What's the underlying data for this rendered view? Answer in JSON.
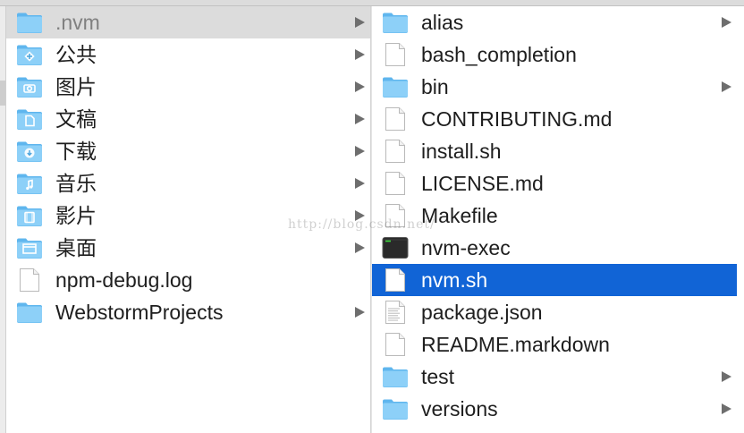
{
  "column1": {
    "items": [
      {
        "label": ".nvm",
        "icon": "folder-icon",
        "has_children": true,
        "selected": "gray"
      },
      {
        "label": "公共",
        "icon": "public-folder-icon",
        "has_children": true
      },
      {
        "label": "图片",
        "icon": "pictures-folder-icon",
        "has_children": true
      },
      {
        "label": "文稿",
        "icon": "documents-folder-icon",
        "has_children": true
      },
      {
        "label": "下载",
        "icon": "downloads-folder-icon",
        "has_children": true
      },
      {
        "label": "音乐",
        "icon": "music-folder-icon",
        "has_children": true
      },
      {
        "label": "影片",
        "icon": "movies-folder-icon",
        "has_children": true
      },
      {
        "label": "桌面",
        "icon": "desktop-folder-icon",
        "has_children": true
      },
      {
        "label": "npm-debug.log",
        "icon": "file-icon",
        "has_children": false
      },
      {
        "label": "WebstormProjects",
        "icon": "folder-icon",
        "has_children": true
      }
    ]
  },
  "column2": {
    "items": [
      {
        "label": "alias",
        "icon": "folder-icon",
        "has_children": true
      },
      {
        "label": "bash_completion",
        "icon": "file-icon",
        "has_children": false
      },
      {
        "label": "bin",
        "icon": "folder-icon",
        "has_children": true
      },
      {
        "label": "CONTRIBUTING.md",
        "icon": "file-icon",
        "has_children": false
      },
      {
        "label": "install.sh",
        "icon": "file-icon",
        "has_children": false
      },
      {
        "label": "LICENSE.md",
        "icon": "file-icon",
        "has_children": false
      },
      {
        "label": "Makefile",
        "icon": "file-icon",
        "has_children": false
      },
      {
        "label": "nvm-exec",
        "icon": "terminal-icon",
        "has_children": false
      },
      {
        "label": "nvm.sh",
        "icon": "file-icon",
        "has_children": false,
        "selected": "blue"
      },
      {
        "label": "package.json",
        "icon": "text-file-icon",
        "has_children": false
      },
      {
        "label": "README.markdown",
        "icon": "file-icon",
        "has_children": false
      },
      {
        "label": "test",
        "icon": "folder-icon",
        "has_children": true
      },
      {
        "label": "versions",
        "icon": "folder-icon",
        "has_children": true
      }
    ]
  },
  "watermark": "http://blog.csdn.net/",
  "colors": {
    "selection_blue": "#1164d6",
    "selection_gray": "#dcdcdc",
    "folder_blue": "#7cc8f6"
  }
}
